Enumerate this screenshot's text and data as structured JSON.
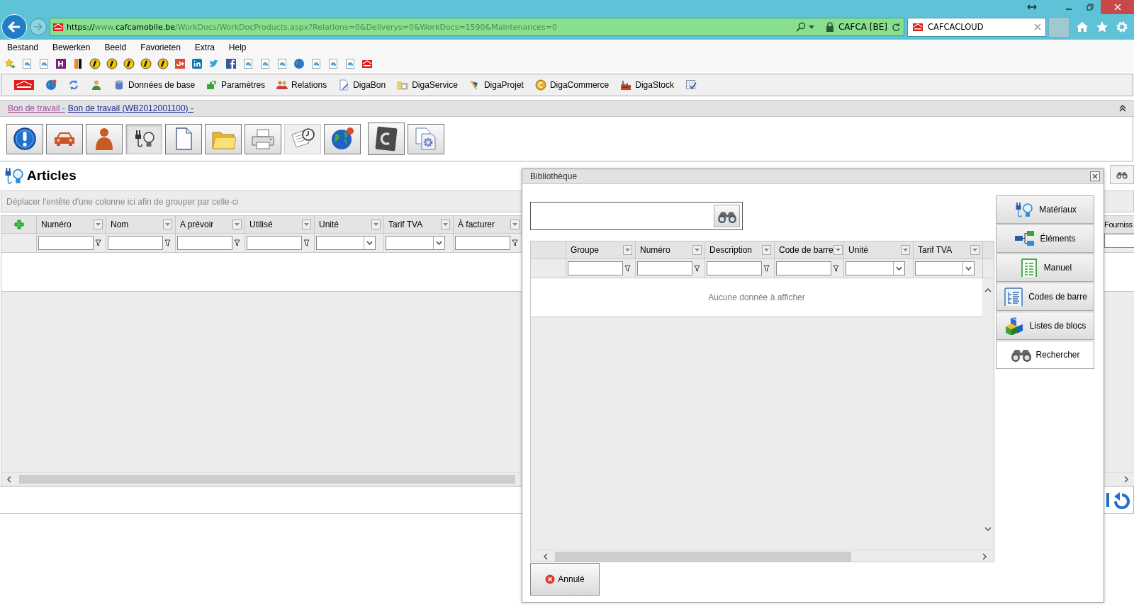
{
  "browser": {
    "url": {
      "scheme": "https://",
      "host_prefix": "www.",
      "domain": "cafcamobile.be",
      "path": "/WorkDocs/WorkDocProducts.aspx?Relations=0&Deliverys=0&WorkDocs=1590&Maintenances=0"
    },
    "site_identity": "CAFCA [BE]",
    "tab": {
      "title": "CAFCACLOUD",
      "selected": true
    }
  },
  "menu": [
    {
      "label": "Bestand"
    },
    {
      "label": "Bewerken"
    },
    {
      "label": "Beeld"
    },
    {
      "label": "Favorieten"
    },
    {
      "label": "Extra"
    },
    {
      "label": "Help"
    }
  ],
  "app_toolbar": [
    {
      "label": "Données de base"
    },
    {
      "label": "Paramètres"
    },
    {
      "label": "Relations"
    },
    {
      "label": "DigaBon"
    },
    {
      "label": "DigaService"
    },
    {
      "label": "DigaProjet"
    },
    {
      "label": "DigaCommerce"
    },
    {
      "label": "DigaStock"
    }
  ],
  "breadcrumb": [
    {
      "text": "Bon de travail -",
      "visited": true
    },
    {
      "text": "Bon de travail (WB2012001100) -",
      "visited": false
    }
  ],
  "section_buttons": [
    {
      "kind": "info",
      "selected": false,
      "disabled": false
    },
    {
      "kind": "car",
      "selected": false,
      "disabled": false
    },
    {
      "kind": "person",
      "selected": false,
      "disabled": false
    },
    {
      "kind": "plug",
      "selected": true,
      "disabled": false
    },
    {
      "kind": "page",
      "selected": false,
      "disabled": false
    },
    {
      "kind": "folder",
      "selected": false,
      "disabled": false
    },
    {
      "kind": "printer",
      "selected": false,
      "disabled": false
    },
    {
      "kind": "clock",
      "selected": false,
      "disabled": true
    },
    {
      "kind": "globe",
      "selected": false,
      "disabled": false
    },
    {
      "kind": "tile",
      "selected": false,
      "disabled": false
    },
    {
      "kind": "gear",
      "selected": false,
      "disabled": false
    }
  ],
  "articles": {
    "title": "Articles",
    "group_hint": "Déplacer l'entête d'une colonne ici afin de grouper par celle-ci",
    "columns": [
      {
        "label": "Numéro",
        "kind": "text"
      },
      {
        "label": "Nom",
        "kind": "text"
      },
      {
        "label": "A prévoir",
        "kind": "text"
      },
      {
        "label": "Utilisé",
        "kind": "text"
      },
      {
        "label": "Unité",
        "kind": "list"
      },
      {
        "label": "Tarif TVA",
        "kind": "list"
      },
      {
        "label": "À facturer",
        "kind": "text"
      }
    ],
    "edge_column": {
      "label": "Fourniss"
    }
  },
  "dialog": {
    "title": "Bibliothèque",
    "columns": [
      {
        "label": "Groupe",
        "kind": "text"
      },
      {
        "label": "Numéro",
        "kind": "text"
      },
      {
        "label": "Description",
        "kind": "text"
      },
      {
        "label": "Code de barre",
        "kind": "text"
      },
      {
        "label": "Unité",
        "kind": "list"
      },
      {
        "label": "Tarif TVA",
        "kind": "list"
      }
    ],
    "empty_text": "Aucune donnée à afficher",
    "side_buttons": [
      {
        "label": "Matériaux",
        "kind": "plug",
        "selected": false
      },
      {
        "label": "Éléments",
        "kind": "nodes",
        "selected": false
      },
      {
        "label": "Manuel",
        "kind": "sheet",
        "selected": false
      },
      {
        "label": "Codes de barre",
        "kind": "list",
        "selected": false
      },
      {
        "label": "Listes de blocs",
        "kind": "blocks",
        "selected": false
      },
      {
        "label": "Rechercher",
        "kind": "binoculars",
        "selected": true
      }
    ],
    "cancel": "Annulé"
  }
}
